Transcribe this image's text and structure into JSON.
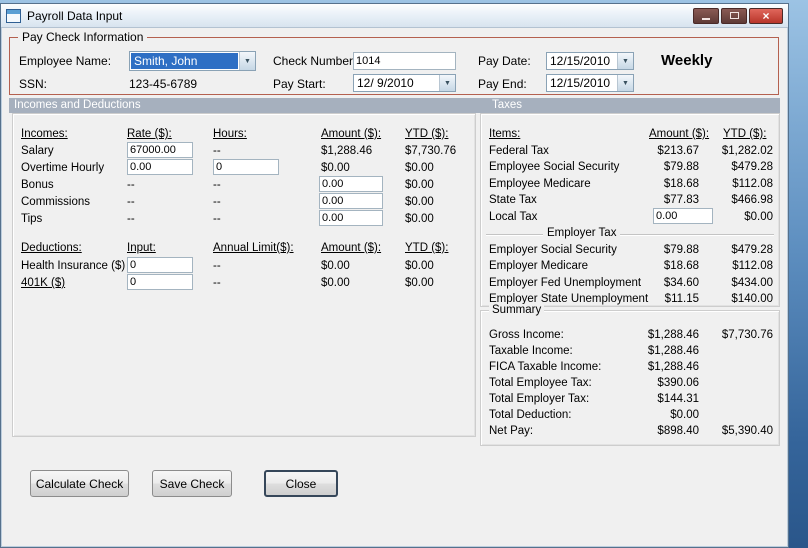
{
  "titlebar": {
    "title": "Payroll Data Input",
    "close_glyph": "×"
  },
  "icons": {
    "dropdown_arrow": "▼"
  },
  "colors": {
    "selection_blue": "#2e6fc4",
    "section_header_bg": "#a6b0be",
    "paycheck_border": "#b4604f",
    "close_button_red": "#c53b30"
  },
  "paycheck": {
    "group_title": "Pay Check Information",
    "employee_name": {
      "label": "Employee Name:",
      "value": "Smith, John"
    },
    "ssn": {
      "label": "SSN:",
      "value": "123-45-6789"
    },
    "check_number": {
      "label": "Check Number:",
      "value": "1014"
    },
    "pay_start": {
      "label": "Pay Start:",
      "value": "12/ 9/2010"
    },
    "pay_date": {
      "label": "Pay Date:",
      "value": "12/15/2010"
    },
    "pay_end": {
      "label": "Pay End:",
      "value": "12/15/2010"
    },
    "frequency": "Weekly"
  },
  "sections": {
    "incomes_deductions": "Incomes and Deductions",
    "taxes": "Taxes"
  },
  "incomes": {
    "headers": {
      "name": "Incomes:",
      "rate": "Rate ($):",
      "hours": "Hours:",
      "amount": "Amount ($):",
      "ytd": "YTD ($):"
    },
    "salary": {
      "label": "Salary",
      "rate": "67000.00",
      "hours": "--",
      "amount": "$1,288.46",
      "ytd": "$7,730.76"
    },
    "overtime": {
      "label": "Overtime Hourly",
      "rate": "0.00",
      "hours": "0",
      "amount": "$0.00",
      "ytd": "$0.00"
    },
    "bonus": {
      "label": "Bonus",
      "rate": "--",
      "hours": "--",
      "amount": "0.00",
      "ytd": "$0.00"
    },
    "commissions": {
      "label": "Commissions",
      "rate": "--",
      "hours": "--",
      "amount": "0.00",
      "ytd": "$0.00"
    },
    "tips": {
      "label": "Tips",
      "rate": "--",
      "hours": "--",
      "amount": "0.00",
      "ytd": "$0.00"
    }
  },
  "deductions": {
    "headers": {
      "name": "Deductions:",
      "input": "Input:",
      "limit": "Annual Limit($):",
      "amount": "Amount ($):",
      "ytd": "YTD ($):"
    },
    "health": {
      "label": "Health Insurance  ($)",
      "input": "0",
      "limit": "--",
      "amount": "$0.00",
      "ytd": "$0.00"
    },
    "k401": {
      "label": "401K  ($)",
      "input": "0",
      "limit": "--",
      "amount": "$0.00",
      "ytd": "$0.00"
    }
  },
  "taxes": {
    "headers": {
      "items": "Items:",
      "amount": "Amount ($):",
      "ytd": "YTD ($):"
    },
    "federal": {
      "label": "Federal Tax",
      "amount": "$213.67",
      "ytd": "$1,282.02"
    },
    "emp_ss": {
      "label": "Employee Social Security",
      "amount": "$79.88",
      "ytd": "$479.28"
    },
    "emp_medicare": {
      "label": "Employee Medicare",
      "amount": "$18.68",
      "ytd": "$112.08"
    },
    "state": {
      "label": "State Tax",
      "amount": "$77.83",
      "ytd": "$466.98"
    },
    "local": {
      "label": "Local Tax",
      "amount": "0.00",
      "ytd": "$0.00"
    },
    "employer_group": "Employer Tax",
    "empr_ss": {
      "label": "Employer Social Security",
      "amount": "$79.88",
      "ytd": "$479.28"
    },
    "empr_medicare": {
      "label": "Employer Medicare",
      "amount": "$18.68",
      "ytd": "$112.08"
    },
    "empr_fed_unemp": {
      "label": "Employer Fed Unemployment",
      "amount": "$34.60",
      "ytd": "$434.00"
    },
    "empr_state_unemp": {
      "label": "Employer State Unemployment",
      "amount": "$11.15",
      "ytd": "$140.00"
    }
  },
  "summary": {
    "group_title": "Summary",
    "gross": {
      "label": "Gross Income:",
      "amount": "$1,288.46",
      "ytd": "$7,730.76"
    },
    "taxable": {
      "label": "Taxable Income:",
      "amount": "$1,288.46",
      "ytd": ""
    },
    "fica": {
      "label": "FICA Taxable Income:",
      "amount": "$1,288.46",
      "ytd": ""
    },
    "total_emp_tax": {
      "label": "Total Employee Tax:",
      "amount": "$390.06",
      "ytd": ""
    },
    "total_empr_tax": {
      "label": "Total Employer Tax:",
      "amount": "$144.31",
      "ytd": ""
    },
    "total_deduction": {
      "label": "Total Deduction:",
      "amount": "$0.00",
      "ytd": ""
    },
    "net_pay": {
      "label": "Net Pay:",
      "amount": "$898.40",
      "ytd": "$5,390.40"
    }
  },
  "buttons": {
    "calculate": "Calculate Check",
    "save": "Save Check",
    "close": "Close"
  }
}
